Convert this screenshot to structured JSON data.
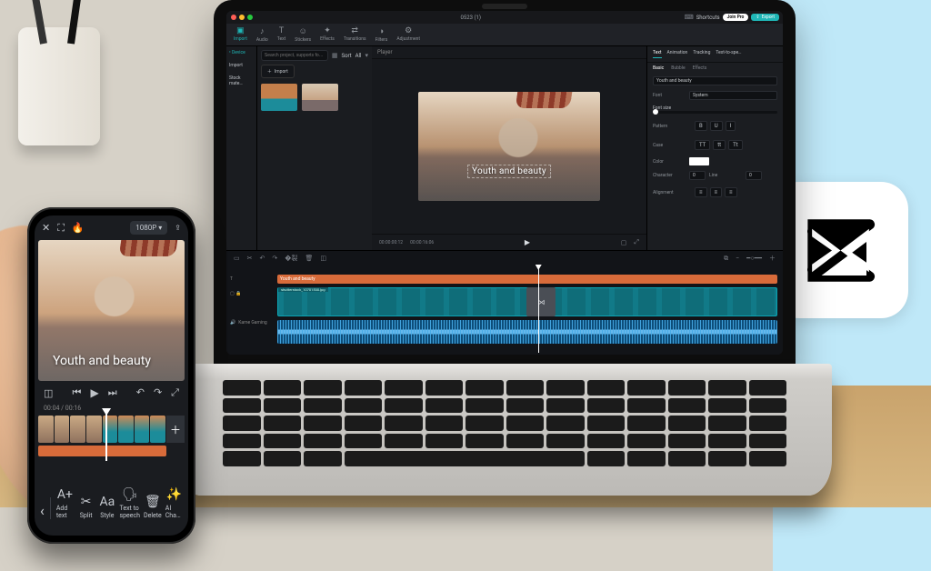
{
  "brand": {
    "name": "CapCut"
  },
  "desktop": {
    "fps_title": "0523 (1)",
    "titlebar_buttons": {
      "shortcuts": "Shortcuts",
      "join_pro": "Join Pro",
      "export": "Export"
    },
    "toolbar": [
      {
        "id": "import",
        "label": "Import",
        "glyph": "▣",
        "active": true
      },
      {
        "id": "audio",
        "label": "Audio",
        "glyph": "♪"
      },
      {
        "id": "text",
        "label": "Text",
        "glyph": "T"
      },
      {
        "id": "stickers",
        "label": "Stickers",
        "glyph": "☺"
      },
      {
        "id": "effects",
        "label": "Effects",
        "glyph": "✦"
      },
      {
        "id": "transitions",
        "label": "Transitions",
        "glyph": "⇄"
      },
      {
        "id": "filters",
        "label": "Filters",
        "glyph": "◑"
      },
      {
        "id": "adjustment",
        "label": "Adjustment",
        "glyph": "⚙"
      }
    ],
    "media_side": {
      "device": "Device",
      "import": "Import",
      "stock": "Stock mate…"
    },
    "media_panel": {
      "import_btn": "Import",
      "search_placeholder": "Search project, supports fo…",
      "sort_label": "Sort",
      "sort_value": "All",
      "thumbs": [
        {
          "file": "shuttersto…"
        },
        {
          "file": "shuttersto…2275179.jpg"
        }
      ]
    },
    "player": {
      "header": "Player",
      "overlay_text": "Youth and beauty",
      "timecode_l": "00:00:00:12",
      "timecode_r": "00:00:16:06"
    },
    "inspector": {
      "tabs": [
        "Text",
        "Animation",
        "Tracking",
        "Text-to-spe…"
      ],
      "active_tab": 0,
      "subtabs": [
        "Basic",
        "Bubble",
        "Effects"
      ],
      "active_sub": 0,
      "text_value": "Youth and beauty",
      "font_label": "Font",
      "font_value": "System",
      "size_label": "Font size",
      "pattern_label": "Pattern",
      "case_label": "Case",
      "case_opts": [
        "TT",
        "tt",
        "Tt"
      ],
      "color_label": "Color",
      "char_label": "Character",
      "char_value": "0",
      "line_label": "Line",
      "line_value": "0",
      "align_label": "Alignment"
    },
    "timeline": {
      "text_track_label": "Youth and beauty",
      "clip_a": "shutterstock_10701530.jpg",
      "clip_b": "shutterstock_807017386.jpg",
      "audio_track_label": "Kame Gaming"
    }
  },
  "mobile": {
    "resolution": "1080P",
    "overlay_text": "Youth and beauty",
    "time": "00:04 / 00:16",
    "bottom_tools": [
      {
        "id": "addtext",
        "label": "Add text",
        "glyph": "A+"
      },
      {
        "id": "split",
        "label": "Split",
        "glyph": "✂"
      },
      {
        "id": "style",
        "label": "Style",
        "glyph": "Aa"
      },
      {
        "id": "tts",
        "label": "Text to speech",
        "glyph": "🗣"
      },
      {
        "id": "delete",
        "label": "Delete",
        "glyph": "🗑"
      },
      {
        "id": "aicha",
        "label": "AI Cha…",
        "glyph": "✨"
      }
    ]
  }
}
